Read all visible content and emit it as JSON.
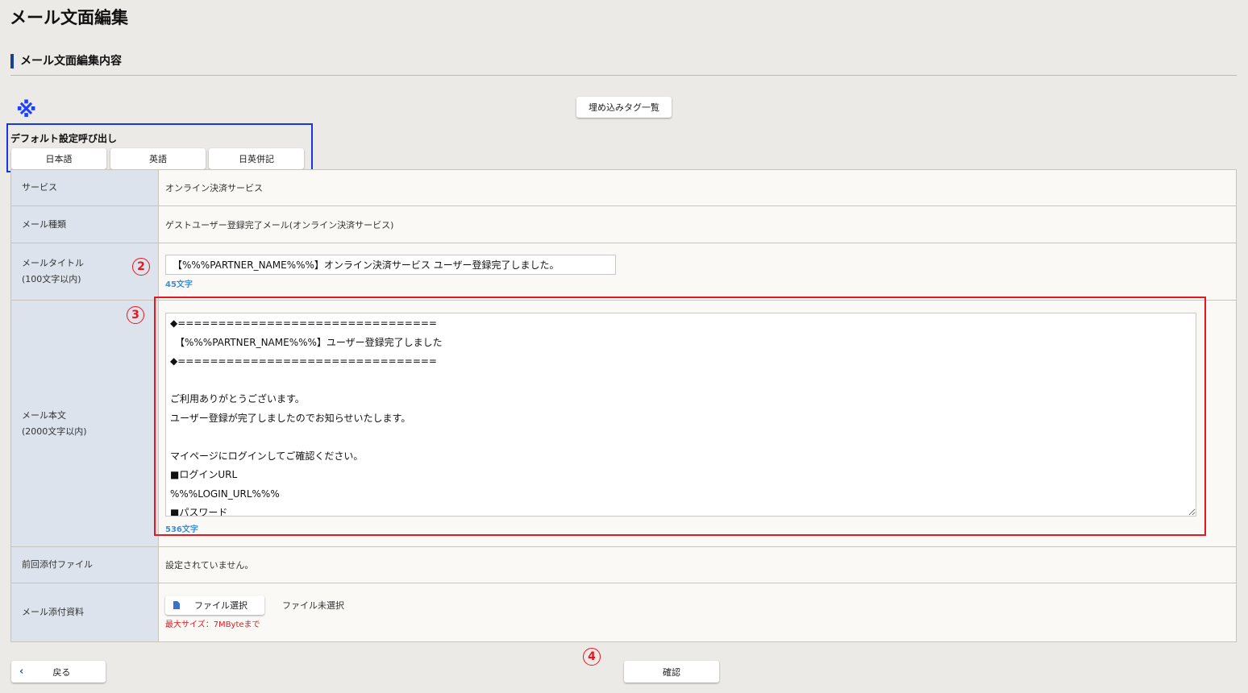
{
  "page": {
    "title": "メール文面編集",
    "section_heading": "メール文面編集内容"
  },
  "toolbar": {
    "tag_list_label": "埋め込みタグ一覧"
  },
  "annotations": {
    "note_mark": "※",
    "marker_2": "2",
    "marker_3": "3",
    "marker_4": "4",
    "box_colors": {
      "default_box": "#1b36e0",
      "body_box": "#e8161e"
    }
  },
  "default_settings": {
    "label": "デフォルト設定呼び出し",
    "buttons": [
      "日本語",
      "英語",
      "日英併記"
    ]
  },
  "form": {
    "service": {
      "label": "サービス",
      "value": "オンライン決済サービス"
    },
    "mail_type": {
      "label": "メール種類",
      "value": "ゲストユーザー登録完了メール(オンライン決済サービス)"
    },
    "mail_title": {
      "label": "メールタイトル",
      "sublabel": "(100文字以内)",
      "value": "【%%%PARTNER_NAME%%%】オンライン決済サービス ユーザー登録完了しました。",
      "count": "45文字"
    },
    "mail_body": {
      "label": "メール本文",
      "sublabel": "(2000文字以内)",
      "value": "◆================================\n　【%%%PARTNER_NAME%%%】ユーザー登録完了しました\n◆================================\n\nご利用ありがとうございます。\nユーザー登録が完了しましたのでお知らせいたします。\n\nマイページにログインしてご確認ください。\n■ログインURL\n%%%LOGIN_URL%%%\n■パスワード",
      "count": "536文字"
    },
    "prev_attachment": {
      "label": "前回添付ファイル",
      "value": "設定されていません。"
    },
    "attachment": {
      "label": "メール添付資料",
      "button_label": "ファイル選択",
      "status": "ファイル未選択",
      "max_size": "最大サイズ：7MByteまで"
    }
  },
  "footer": {
    "back_label": "戻る",
    "confirm_label": "確認"
  }
}
